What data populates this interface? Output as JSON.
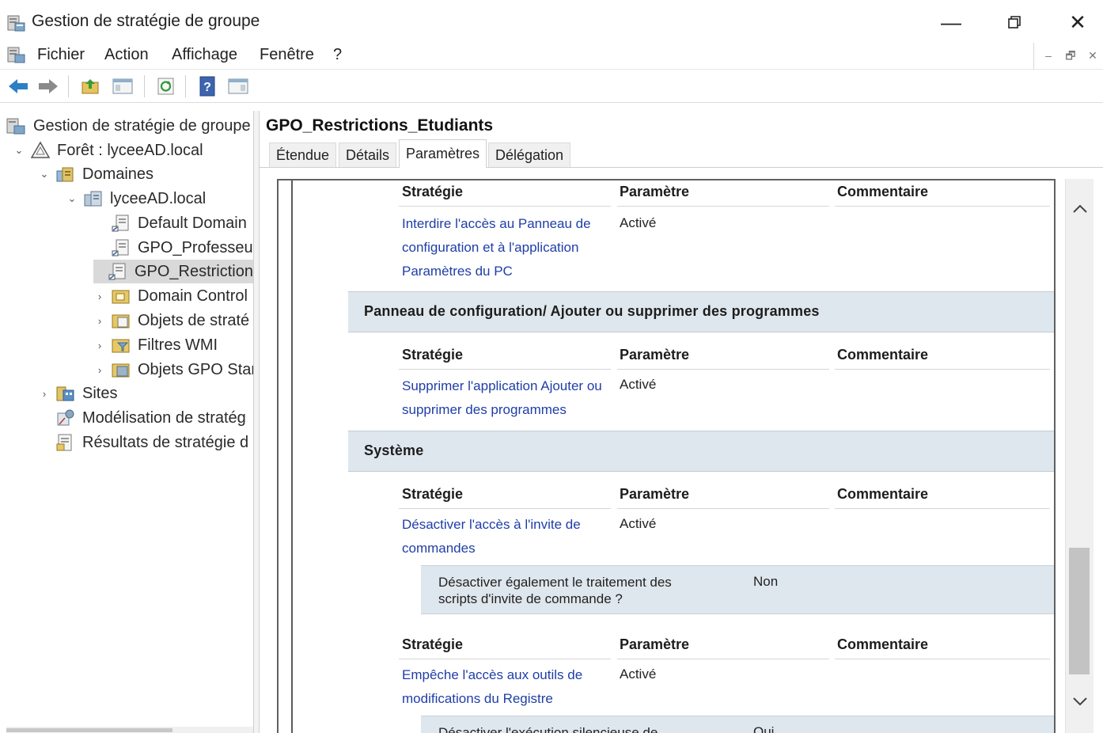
{
  "window": {
    "title": "Gestion de stratégie de groupe",
    "controls": {
      "minimize": "—",
      "maximize": "❐",
      "close": "✕"
    }
  },
  "menu": {
    "items": [
      "Fichier",
      "Action",
      "Affichage",
      "Fenêtre",
      "?"
    ],
    "mdi_controls": [
      "–",
      "🗗",
      "✕"
    ]
  },
  "toolbar": {
    "icons": [
      "back-arrow-icon",
      "forward-arrow-icon",
      "up-folder-icon",
      "show-hide-tree-icon",
      "refresh-icon",
      "help-icon",
      "action-pane-icon"
    ]
  },
  "tree": {
    "items": [
      {
        "label": "Gestion de stratégie de groupe",
        "icon": "gpmc-root-icon",
        "indent": 0,
        "chevron": ""
      },
      {
        "label": "Forêt : lyceeAD.local",
        "icon": "forest-icon",
        "indent": 1,
        "chevron": "⌄"
      },
      {
        "label": "Domaines",
        "icon": "domains-icon",
        "indent": 2,
        "chevron": "⌄"
      },
      {
        "label": "lyceeAD.local",
        "icon": "domain-icon",
        "indent": 3,
        "chevron": "⌄"
      },
      {
        "label": "Default Domain",
        "icon": "gpo-link-icon",
        "indent": 4,
        "chevron": ""
      },
      {
        "label": "GPO_Professeur",
        "icon": "gpo-link-icon",
        "indent": 4,
        "chevron": ""
      },
      {
        "label": "GPO_Restriction",
        "icon": "gpo-link-icon",
        "indent": 4,
        "chevron": "",
        "selected": true
      },
      {
        "label": "Domain Control",
        "icon": "ou-icon",
        "indent": 4,
        "chevron": "›"
      },
      {
        "label": "Objets de straté",
        "icon": "gpo-container-icon",
        "indent": 4,
        "chevron": "›"
      },
      {
        "label": "Filtres WMI",
        "icon": "wmi-filter-icon",
        "indent": 4,
        "chevron": "›"
      },
      {
        "label": "Objets GPO Star",
        "icon": "starter-gpo-icon",
        "indent": 4,
        "chevron": "›"
      },
      {
        "label": "Sites",
        "icon": "sites-icon",
        "indent": 2,
        "chevron": "›"
      },
      {
        "label": "Modélisation de stratég",
        "icon": "modeling-icon",
        "indent": 2,
        "chevron": ""
      },
      {
        "label": "Résultats de stratégie d",
        "icon": "results-icon",
        "indent": 2,
        "chevron": ""
      }
    ]
  },
  "main": {
    "gpo_name": "GPO_Restrictions_Etudiants",
    "tabs": [
      {
        "label": "Étendue",
        "active": false
      },
      {
        "label": "Détails",
        "active": false
      },
      {
        "label": "Paramètres",
        "active": true
      },
      {
        "label": "Délégation",
        "active": false
      }
    ],
    "columns": {
      "policy": "Stratégie",
      "setting": "Paramètre",
      "comment": "Commentaire"
    },
    "block1": {
      "policy": "Interdire l'accès au Panneau de configuration et à l'application Paramètres du PC",
      "setting": "Activé"
    },
    "section2": {
      "title": "Panneau de configuration/ Ajouter ou supprimer des programmes",
      "policy": "Supprimer l'application Ajouter ou supprimer des programmes",
      "setting": "Activé"
    },
    "section3": {
      "title": "Système",
      "policy1": "Désactiver l'accès à l'invite de commandes",
      "setting1": "Activé",
      "option1_text": "Désactiver également le traitement des scripts d'invite de commande ?",
      "option1_value": "Non",
      "policy2": "Empêche l'accès aux outils de modifications du Registre",
      "setting2": "Activé",
      "option2_text": "Désactiver l'exécution silencieuse de",
      "option2_value": "Oui"
    }
  },
  "scrollbar": {
    "up": "⌃",
    "down": "⌄"
  },
  "colors": {
    "link": "#1f3ea8",
    "section_band": "#dfe7ee",
    "selected_tree": "#d9d9d9"
  }
}
